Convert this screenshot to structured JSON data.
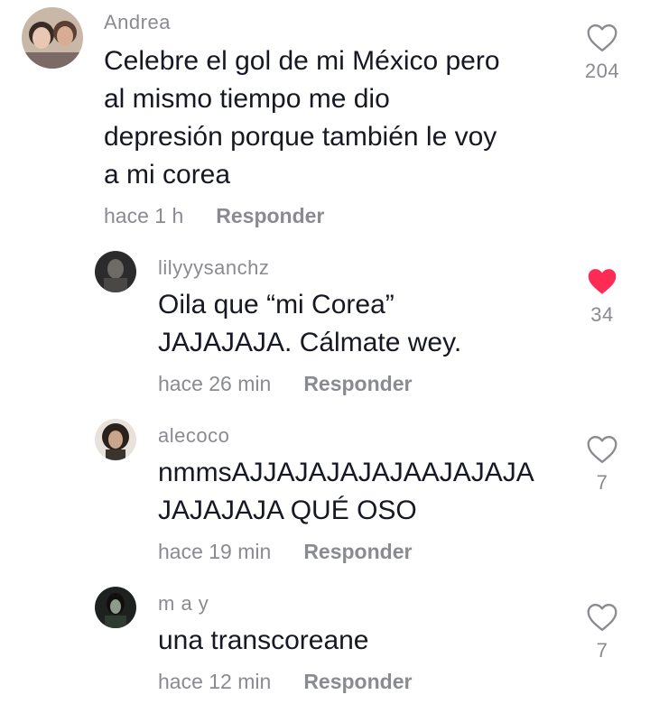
{
  "comments": [
    {
      "username": "Andrea",
      "text": "Celebre el gol de mi México pero\nal mismo tiempo me dio\ndepresión porque también le voy\na mi corea",
      "time": "hace 1 h",
      "reply_label": "Responder",
      "likes": "204",
      "liked": false
    },
    {
      "username": "lilyyysanchz",
      "text": "Oila que “mi Corea”\nJAJAJAJA. Cálmate wey.",
      "time": "hace 26 min",
      "reply_label": "Responder",
      "likes": "34",
      "liked": true
    },
    {
      "username": "alecoco",
      "text": "nmmsAJJAJAJAJAJAAJAJAJA\nJAJAJAJA QUÉ OSO",
      "time": "hace 19 min",
      "reply_label": "Responder",
      "likes": "7",
      "liked": false
    },
    {
      "username": "m a y",
      "text": "una transcoreane",
      "time": "hace 12 min",
      "reply_label": "Responder",
      "likes": "7",
      "liked": false
    }
  ],
  "colors": {
    "like_active": "#fe2c55",
    "secondary_text": "#8a8b91"
  },
  "icons": {
    "like": "heart-outline-icon",
    "liked": "heart-filled-icon"
  }
}
